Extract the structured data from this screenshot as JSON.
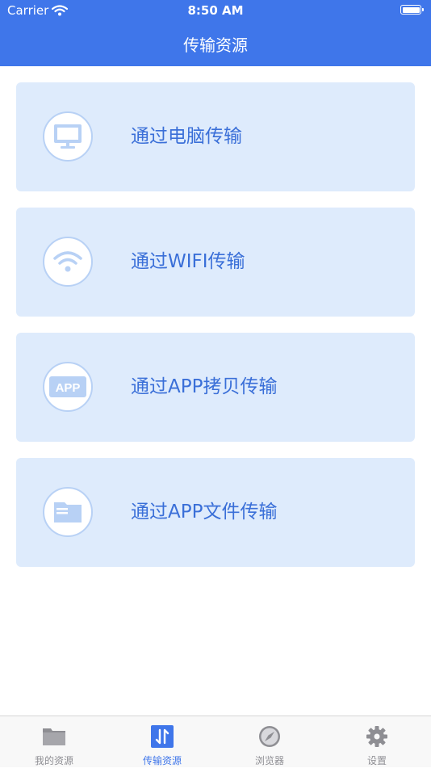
{
  "status_bar": {
    "carrier": "Carrier",
    "time": "8:50 AM"
  },
  "nav": {
    "title": "传输资源"
  },
  "options": [
    {
      "label": "通过电脑传输",
      "icon": "monitor-icon"
    },
    {
      "label": "通过WIFI传输",
      "icon": "wifi-icon"
    },
    {
      "label": "通过APP拷贝传输",
      "icon": "app-icon",
      "icon_text": "APP"
    },
    {
      "label": "通过APP文件传输",
      "icon": "folder-icon"
    }
  ],
  "tabs": [
    {
      "label": "我的资源",
      "icon": "folder-icon",
      "active": false
    },
    {
      "label": "传输资源",
      "icon": "transfer-icon",
      "active": true
    },
    {
      "label": "浏览器",
      "icon": "compass-icon",
      "active": false
    },
    {
      "label": "设置",
      "icon": "gear-icon",
      "active": false
    }
  ],
  "colors": {
    "primary": "#3f76ea",
    "card_bg": "#deebfc",
    "icon_fill": "#b8d1f5",
    "tab_inactive": "#8e8e93"
  }
}
